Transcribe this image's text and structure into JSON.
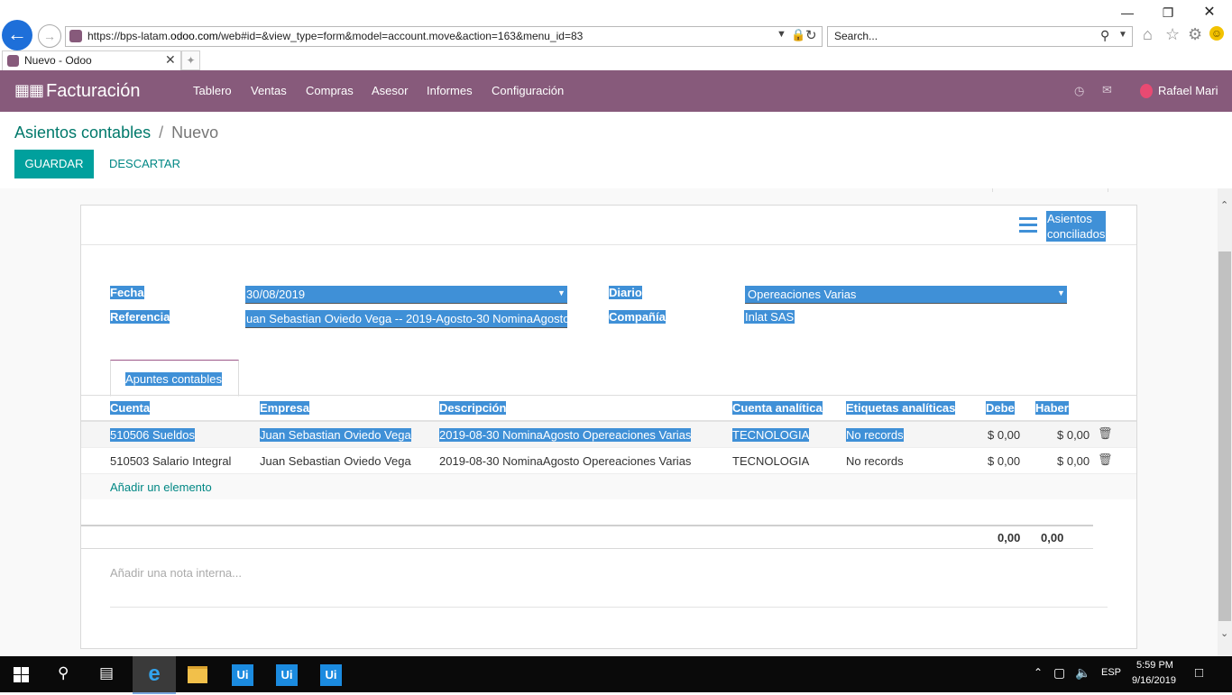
{
  "browser": {
    "url_prefix": "https://bps-latam.",
    "url_domain": "odoo.com",
    "url_suffix": "/web#id=&view_type=form&model=account.move&action=163&menu_id=83",
    "search_placeholder": "Search...",
    "tab_title": "Nuevo - Odoo"
  },
  "navbar": {
    "app_name": "Facturación",
    "menu": [
      "Tablero",
      "Ventas",
      "Compras",
      "Asesor",
      "Informes",
      "Configuración"
    ],
    "user": "Rafael Mari"
  },
  "breadcrumb": {
    "parent": "Asientos contables",
    "separator": "/",
    "current": "Nuevo"
  },
  "buttons": {
    "save": "GUARDAR",
    "discard": "DESCARTAR"
  },
  "smart_button": {
    "line1": "Asientos",
    "line2": "conciliados"
  },
  "form": {
    "fecha_label": "Fecha",
    "fecha_value": "30/08/2019",
    "referencia_label": "Referencia",
    "referencia_value": "uan Sebastian Oviedo Vega -- 2019-Agosto-30 NominaAgosto",
    "diario_label": "Diario",
    "diario_value": "Opereaciones Varias",
    "compania_label": "Compañía",
    "compania_value": "Inlat SAS"
  },
  "tab_label": "Apuntes contables",
  "table": {
    "headers": [
      "Cuenta",
      "Empresa",
      "Descripción",
      "Cuenta analítica",
      "Etiquetas analíticas",
      "Debe",
      "Haber"
    ],
    "rows": [
      {
        "cuenta": "510506 Sueldos",
        "empresa": "Juan Sebastian Oviedo Vega",
        "descripcion": "2019-08-30 NominaAgosto Opereaciones Varias",
        "cuenta_analitica": "TECNOLOGIA",
        "etiquetas": "No records",
        "debe": "$ 0,00",
        "haber": "$ 0,00"
      },
      {
        "cuenta": "510503 Salario Integral",
        "empresa": "Juan Sebastian Oviedo Vega",
        "descripcion": "2019-08-30 NominaAgosto Opereaciones Varias",
        "cuenta_analitica": "TECNOLOGIA",
        "etiquetas": "No records",
        "debe": "$ 0,00",
        "haber": "$ 0,00"
      }
    ],
    "add_line": "Añadir un elemento",
    "total_debe": "0,00",
    "total_haber": "0,00"
  },
  "note_placeholder": "Añadir una nota interna...",
  "taskbar": {
    "lang": "ESP",
    "time": "5:59 PM",
    "date": "9/16/2019"
  },
  "colors": {
    "odoo_purple": "#875a7b",
    "teal": "#00a09d",
    "link": "#008784",
    "selection": "#3f90d7"
  }
}
